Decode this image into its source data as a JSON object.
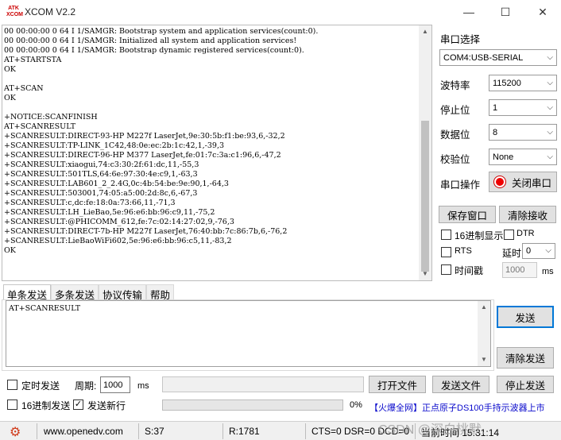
{
  "window": {
    "logo": "ATK\nXCOM",
    "title": "XCOM V2.2",
    "minimize": "—",
    "maximize": "☐",
    "close": "✕"
  },
  "receive": {
    "text": "00 00:00:00 0 64 I 1/SAMGR: Bootstrap system and application services(count:0).\n00 00:00:00 0 64 I 1/SAMGR: Initialized all system and application services!\n00 00:00:00 0 64 I 1/SAMGR: Bootstrap dynamic registered services(count:0).\nAT+STARTSTA\nOK\n\nAT+SCAN\nOK\n\n+NOTICE:SCANFINISH\nAT+SCANRESULT\n+SCANRESULT:DIRECT-93-HP M227f LaserJet,9e:30:5b:f1:be:93,6,-32,2\n+SCANRESULT:TP-LINK_1C42,48:0e:ec:2b:1c:42,1,-39,3\n+SCANRESULT:DIRECT-96-HP M377 LaserJet,fe:01:7c:3a:c1:96,6,-47,2\n+SCANRESULT:xiaogui,74:c3:30:2f:61:dc,11,-55,3\n+SCANRESULT:501TLS,64:6e:97:30:4e:c9,1,-63,3\n+SCANRESULT:LAB601_2_2.4G,0c:4b:54:be:9e:90,1,-64,3\n+SCANRESULT:503001,74:05:a5:00:2d:8c,6,-67,3\n+SCANRESULT:c,dc:fe:18:0a:73:66,11,-71,3\n+SCANRESULT:LH_LieBao,5e:96:e6:bb:96:c9,11,-75,2\n+SCANRESULT:@PHICOMM_612,fe:7c:02:14:27:02,9,-76,3\n+SCANRESULT:DIRECT-7b-HP M227f LaserJet,76:40:bb:7c:86:7b,6,-76,2\n+SCANRESULT:LieBaoWiFi602,5e:96:e6:bb:96:c5,11,-83,2\nOK"
  },
  "settings": {
    "port_select_label": "串口选择",
    "port_value": "COM4:USB-SERIAL",
    "baud_label": "波特率",
    "baud_value": "115200",
    "stop_label": "停止位",
    "stop_value": "1",
    "data_label": "数据位",
    "data_value": "8",
    "parity_label": "校验位",
    "parity_value": "None",
    "port_op_label": "串口操作",
    "close_port": "关闭串口",
    "save_window": "保存窗口",
    "clear_recv": "清除接收",
    "hex_display": "16进制显示",
    "dtr": "DTR",
    "rts": "RTS",
    "delay_label": "延时",
    "delay_value": "0",
    "timestamp": "时间戳",
    "timestamp_value": "1000",
    "ms": "ms"
  },
  "tabs": [
    "单条发送",
    "多条发送",
    "协议传输",
    "帮助"
  ],
  "send": {
    "text": "AT+SCANRESULT",
    "send_button": "发送",
    "clear_send": "清除发送",
    "timed_send": "定时发送",
    "period_label": "周期:",
    "period_value": "1000",
    "ms": "ms",
    "open_file": "打开文件",
    "send_file": "发送文件",
    "stop_send": "停止发送",
    "hex_send": "16进制发送",
    "send_newline": "发送新行",
    "progress": "0%",
    "ad_link": "【火爆全网】正点原子DS100手持示波器上市"
  },
  "status": {
    "url": "www.openedv.com",
    "s": "S:37",
    "r": "R:1781",
    "signals": "CTS=0 DSR=0 DCD=0",
    "time": "当前时间 15:31:14",
    "watermark": "CSDN @深白桃默."
  }
}
